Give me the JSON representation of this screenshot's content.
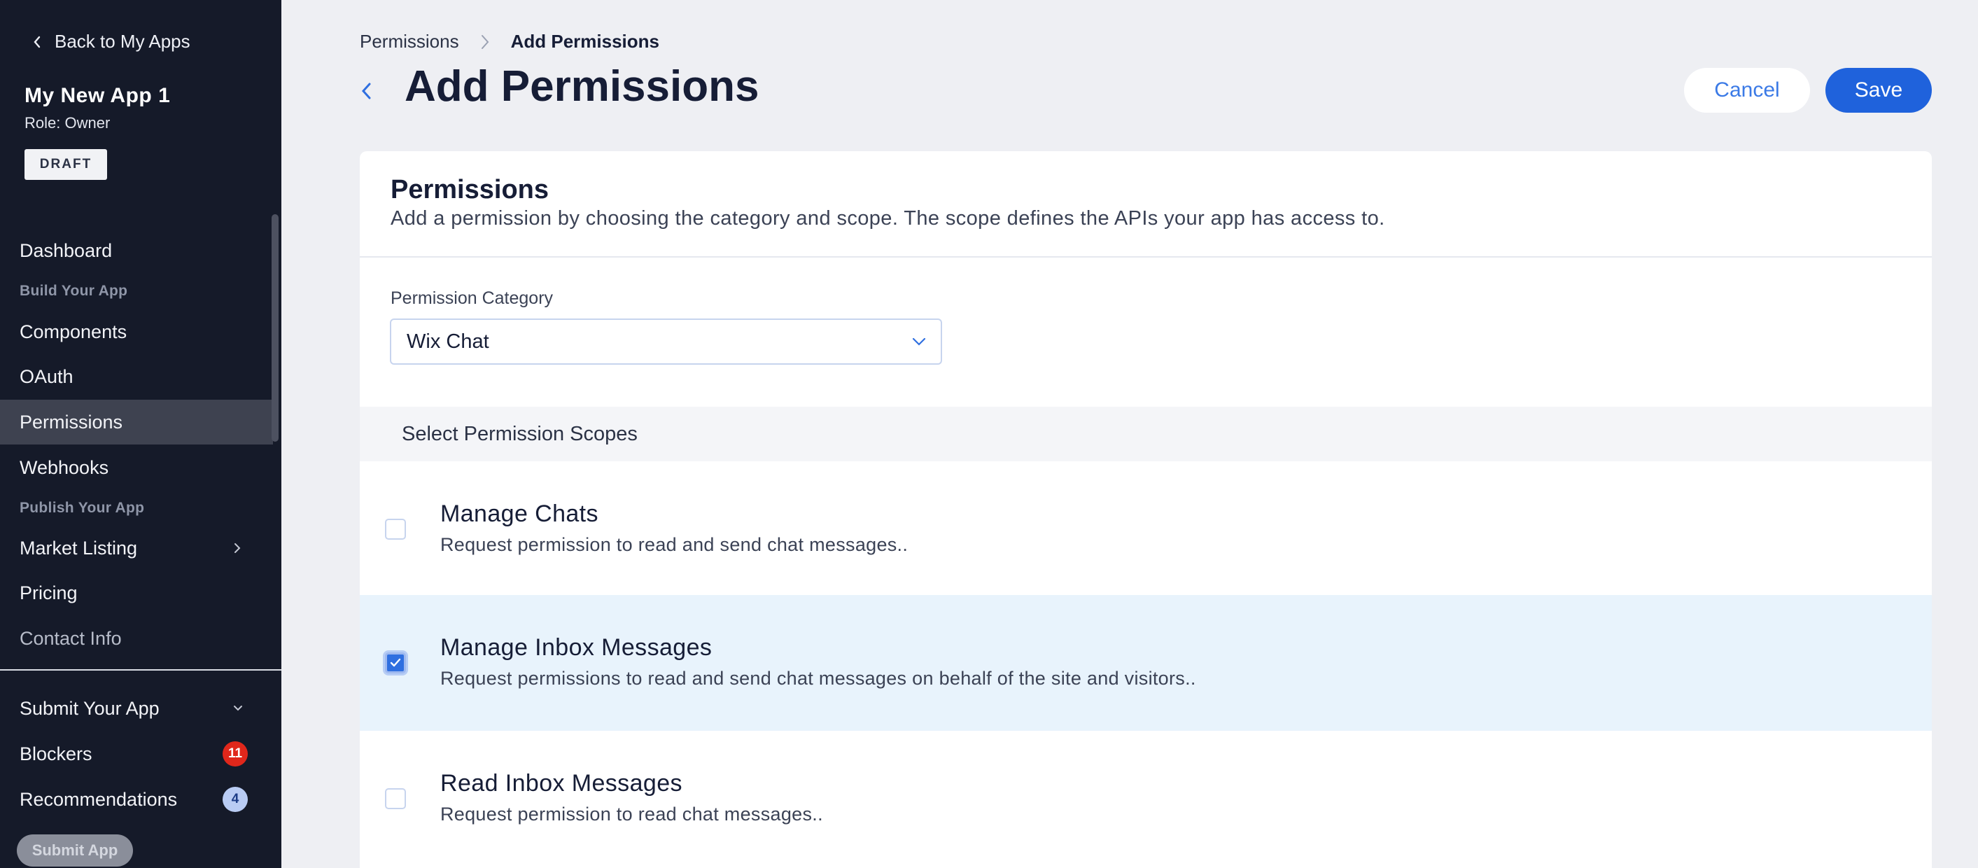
{
  "sidebar": {
    "back_label": "Back to My Apps",
    "app_name": "My New App 1",
    "app_role": "Role: Owner",
    "status_badge": "DRAFT",
    "nav": {
      "dashboard": "Dashboard",
      "section_build": "Build Your App",
      "components": "Components",
      "oauth": "OAuth",
      "permissions": "Permissions",
      "webhooks": "Webhooks",
      "section_publish": "Publish Your App",
      "market_listing": "Market Listing",
      "pricing": "Pricing",
      "contact_info": "Contact Info",
      "submit_your_app": "Submit Your App",
      "blockers": "Blockers",
      "blockers_count": "11",
      "recommendations": "Recommendations",
      "recommendations_count": "4"
    },
    "submit_button": "Submit App"
  },
  "breadcrumb": {
    "parent": "Permissions",
    "current": "Add Permissions"
  },
  "header": {
    "title": "Add Permissions",
    "cancel_label": "Cancel",
    "save_label": "Save"
  },
  "card": {
    "title": "Permissions",
    "subtitle": "Add a permission by choosing the category and scope. The scope defines the APIs your app has access to.",
    "category_label": "Permission Category",
    "category_value": "Wix Chat",
    "scopes_header": "Select Permission Scopes",
    "scopes": [
      {
        "title": "Manage Chats",
        "description": "Request permission to read and send chat messages..",
        "checked": false
      },
      {
        "title": "Manage Inbox Messages",
        "description": "Request permissions to read and send chat messages on behalf of the site and visitors..",
        "checked": true
      },
      {
        "title": "Read Inbox Messages",
        "description": "Request permission to read chat messages..",
        "checked": false
      }
    ]
  },
  "colors": {
    "sidebar_bg": "#151a29",
    "accent": "#1f62dc",
    "selected_row": "#e8f3fc",
    "blocker_badge": "#e0271b"
  }
}
